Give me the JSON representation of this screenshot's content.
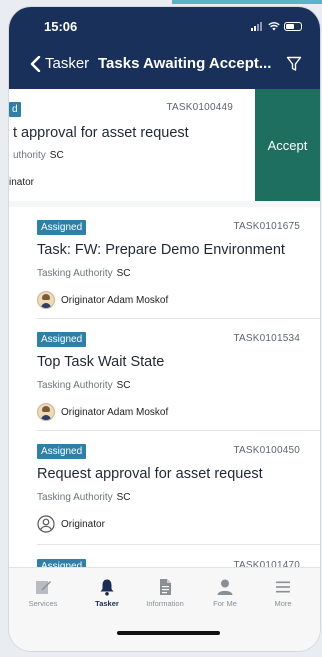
{
  "status_bar": {
    "time": "15:06"
  },
  "nav": {
    "back_label": "Tasker",
    "title": "Tasks Awaiting Accept..."
  },
  "swiped_task": {
    "badge": "d",
    "id": "TASK0100449",
    "title": "t approval for asset request",
    "authority_label": "uthority",
    "authority_value": "SC",
    "originator": "inator",
    "action_label": "Accept"
  },
  "tasks": [
    {
      "badge": "Assigned",
      "id": "TASK0101675",
      "title": "Task: FW: Prepare Demo Environment",
      "authority_label": "Tasking Authority",
      "authority_value": "SC",
      "originator": "Originator Adam Moskof"
    },
    {
      "badge": "Assigned",
      "id": "TASK0101534",
      "title": "Top Task Wait State",
      "authority_label": "Tasking Authority",
      "authority_value": "SC",
      "originator": "Originator Adam Moskof"
    },
    {
      "badge": "Assigned",
      "id": "TASK0100450",
      "title": "Request approval for asset request",
      "authority_label": "Tasking Authority",
      "authority_value": "SC",
      "originator": "Originator"
    },
    {
      "badge": "Assigned",
      "id": "TASK0101470"
    }
  ],
  "tabbar": {
    "items": [
      {
        "label": "Services",
        "icon": "edit-icon"
      },
      {
        "label": "Tasker",
        "icon": "bell-icon"
      },
      {
        "label": "Information",
        "icon": "document-icon"
      },
      {
        "label": "For Me",
        "icon": "person-icon"
      },
      {
        "label": "More",
        "icon": "menu-icon"
      }
    ]
  },
  "colors": {
    "header": "#19305b",
    "badge": "#2f7fa7",
    "accept": "#1f6f60",
    "active_tab": "#1b2d53"
  }
}
